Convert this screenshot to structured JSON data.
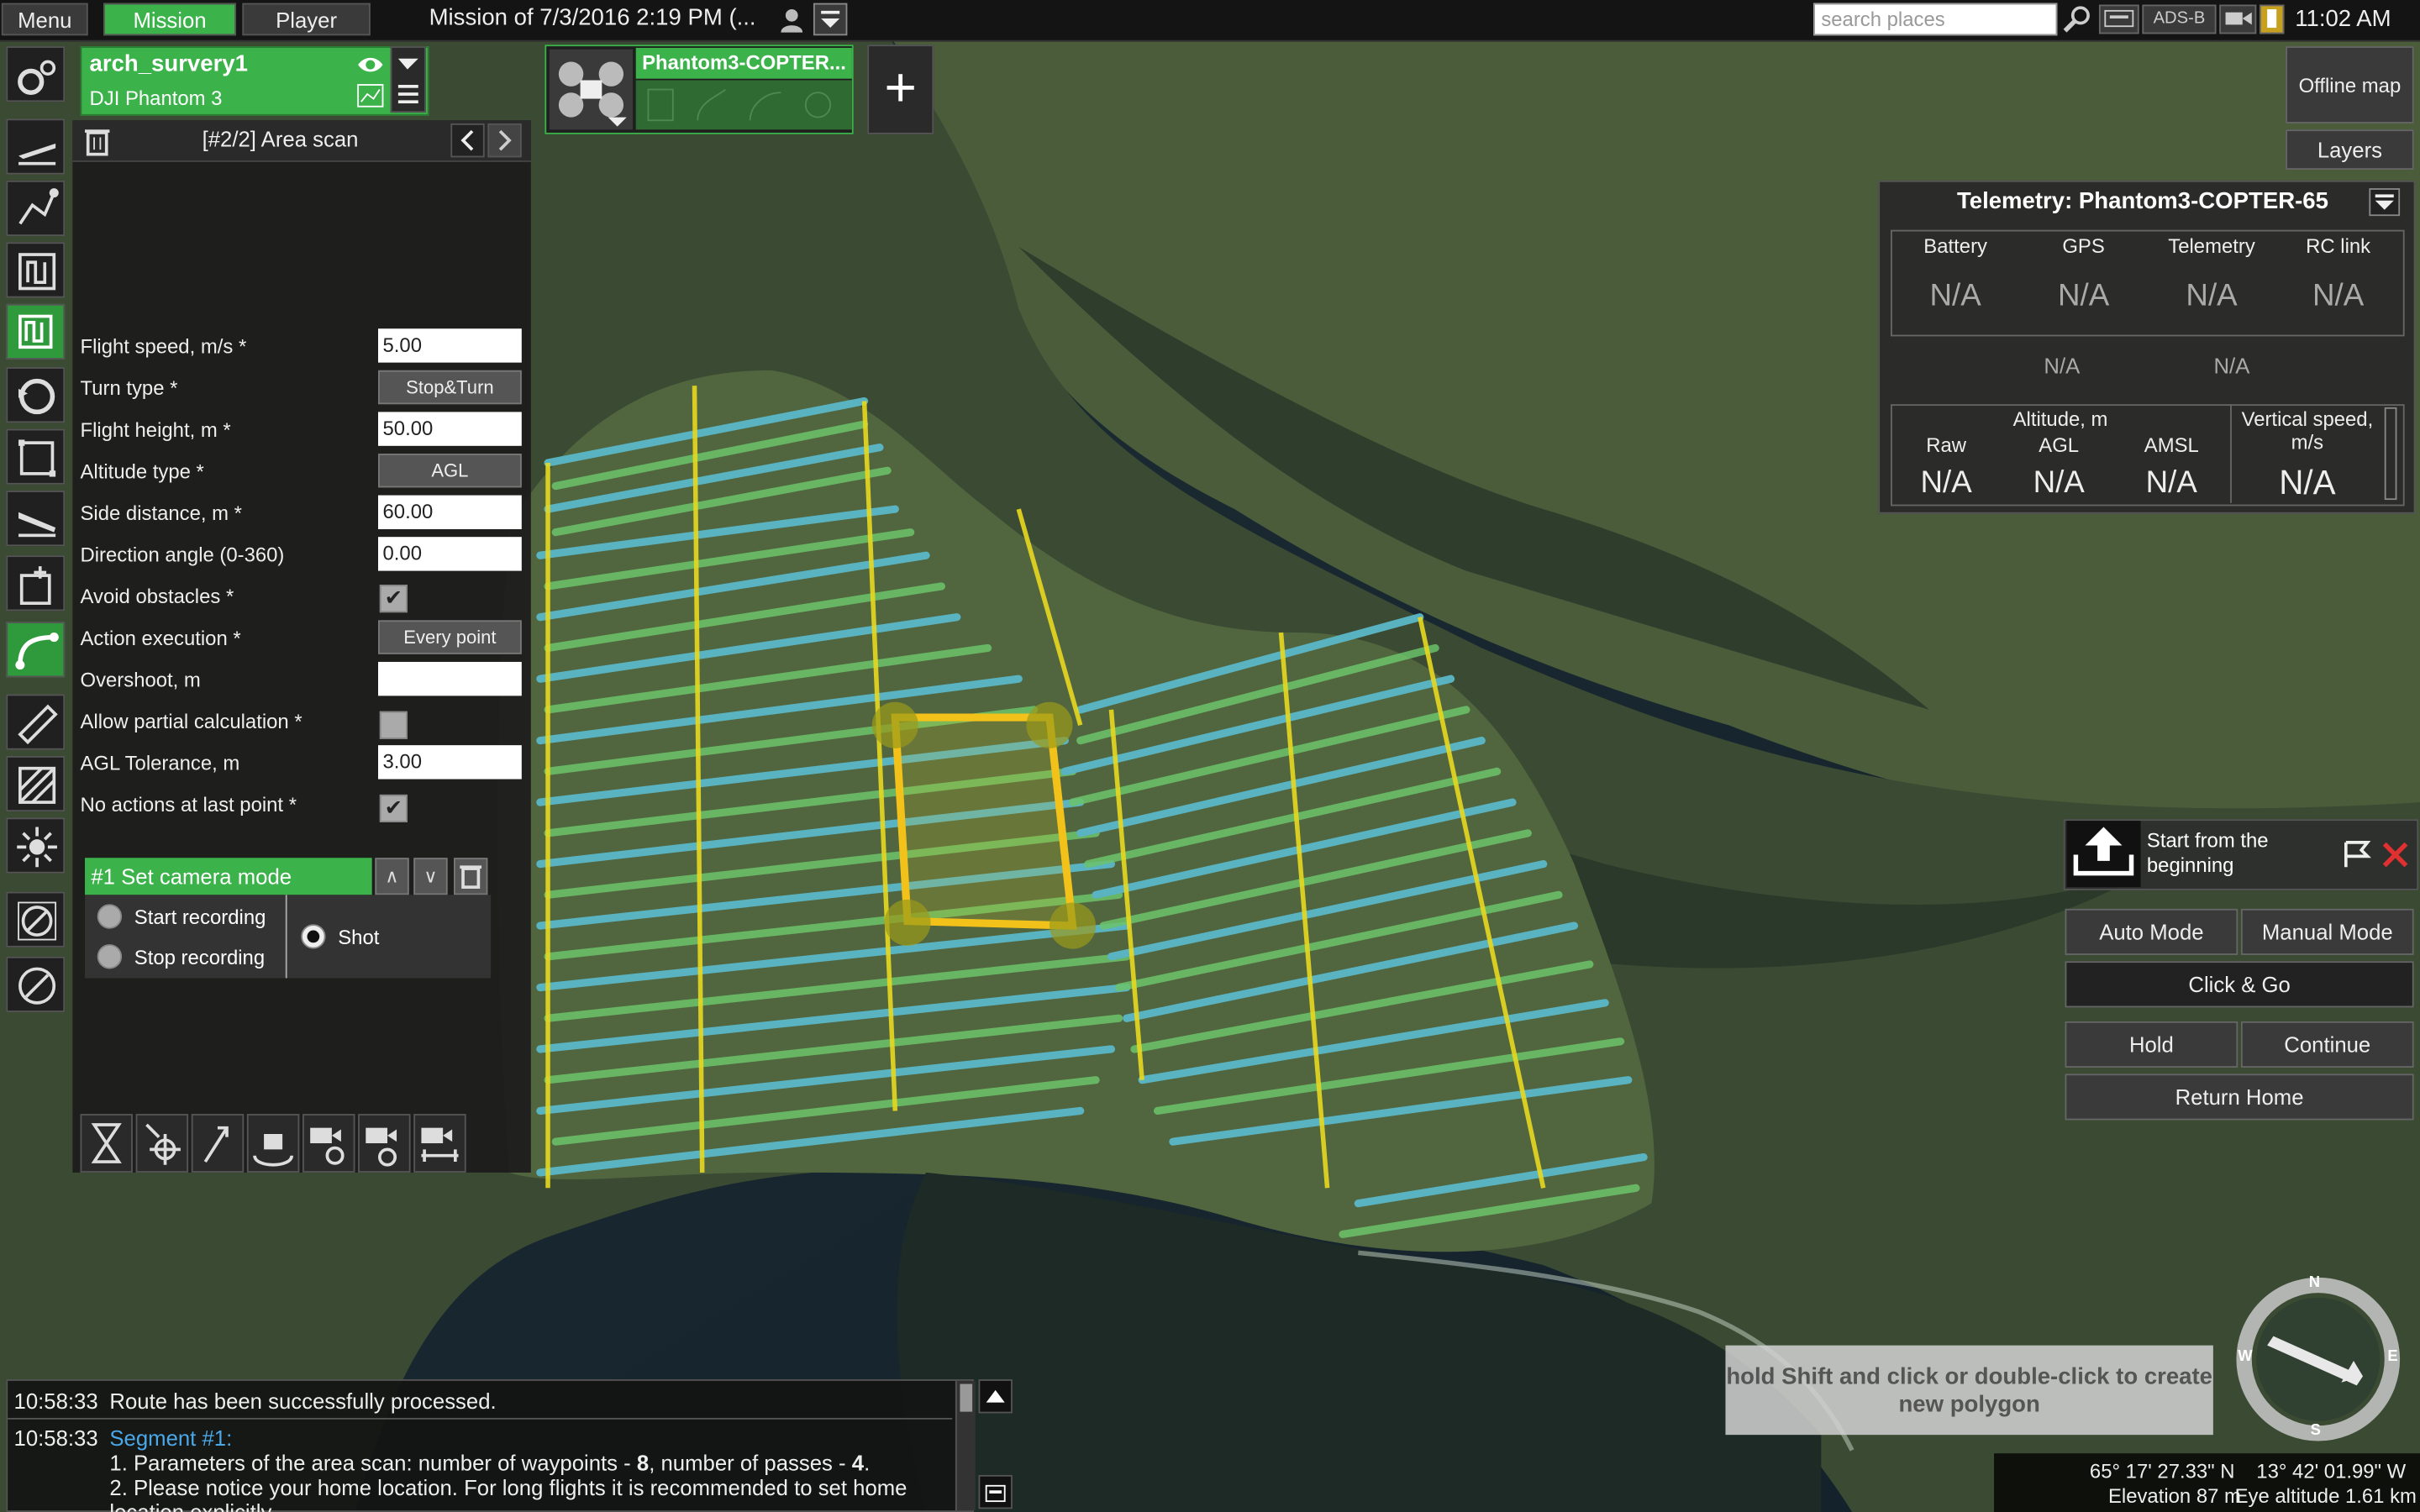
{
  "topbar": {
    "menu_label": "Menu",
    "mission_tab": "Mission",
    "player_tab": "Player",
    "mission_title": "Mission of 7/3/2016 2:19 PM (...",
    "search_placeholder": "search places",
    "adsb_label": "ADS-B",
    "clock": "11:02 AM"
  },
  "vehicle": {
    "name": "arch_survery1",
    "model": "DJI Phantom 3"
  },
  "vehicle_tab": {
    "label": "Phantom3-COPTER...",
    "add_label": "+"
  },
  "panel": {
    "title": "[#2/2] Area scan",
    "fields": [
      {
        "label": "Flight speed, m/s *",
        "value": "5.00"
      },
      {
        "label": "Turn type *",
        "value": "Stop&Turn"
      },
      {
        "label": "Flight height, m *",
        "value": "50.00"
      },
      {
        "label": "Altitude type *",
        "value": "AGL"
      },
      {
        "label": "Side distance, m *",
        "value": "60.00"
      },
      {
        "label": "Direction angle (0-360)",
        "value": "0.00"
      },
      {
        "label": "Avoid obstacles *",
        "value": "checked"
      },
      {
        "label": "Action execution *",
        "value": "Every point"
      },
      {
        "label": "Overshoot, m",
        "value": ""
      },
      {
        "label": "Allow partial calculation *",
        "value": "unchecked"
      },
      {
        "label": "AGL Tolerance, m",
        "value": "3.00"
      },
      {
        "label": "No actions at last point *",
        "value": "checked"
      }
    ],
    "action": {
      "title": "#1 Set camera mode",
      "options": [
        "Start recording",
        "Stop recording",
        "Shot"
      ],
      "selected": "Shot"
    }
  },
  "right": {
    "offline_map": "Offline map",
    "layers": "Layers",
    "telemetry_title": "Telemetry: Phantom3-COPTER-65",
    "status_headers": [
      "Battery",
      "GPS",
      "Telemetry",
      "RC link"
    ],
    "status_values": [
      "N/A",
      "N/A",
      "N/A",
      "N/A"
    ],
    "mid_values": [
      "N/A",
      "N/A"
    ],
    "altitude_header": "Altitude, m",
    "altitude_cols": [
      "Raw",
      "AGL",
      "AMSL"
    ],
    "altitude_values": [
      "N/A",
      "N/A",
      "N/A"
    ],
    "vspeed_header": "Vertical speed, m/s",
    "vspeed_value": "N/A",
    "start_text": "Start from the beginning",
    "auto_mode": "Auto Mode",
    "manual_mode": "Manual Mode",
    "click_go": "Click & Go",
    "hold": "Hold",
    "continue": "Continue",
    "return_home": "Return Home"
  },
  "hint": "hold Shift and click or double-click to create new polygon",
  "log": {
    "entries": [
      {
        "time": "10:58:33",
        "text": "Route has been successfully processed."
      },
      {
        "time": "10:58:33",
        "segment": "Segment #1:"
      }
    ],
    "line1_prefix": "1. Parameters of the area scan: number of waypoints - ",
    "line1_wp": "8",
    "line1_mid": ", number of passes - ",
    "line1_passes": "4",
    "line1_end": ".",
    "line2": "2. Please notice your home location. For long flights it is recommended to set home",
    "line3": "location explicitly"
  },
  "coords": {
    "lat": "65° 17' 27.33\" N",
    "lon": "13° 42' 01.99\" W",
    "elevation": "Elevation 87 m",
    "eye_altitude": "Eye altitude 1.61 km"
  },
  "compass": {
    "n": "N",
    "s": "S",
    "e": "E",
    "w": "W"
  }
}
